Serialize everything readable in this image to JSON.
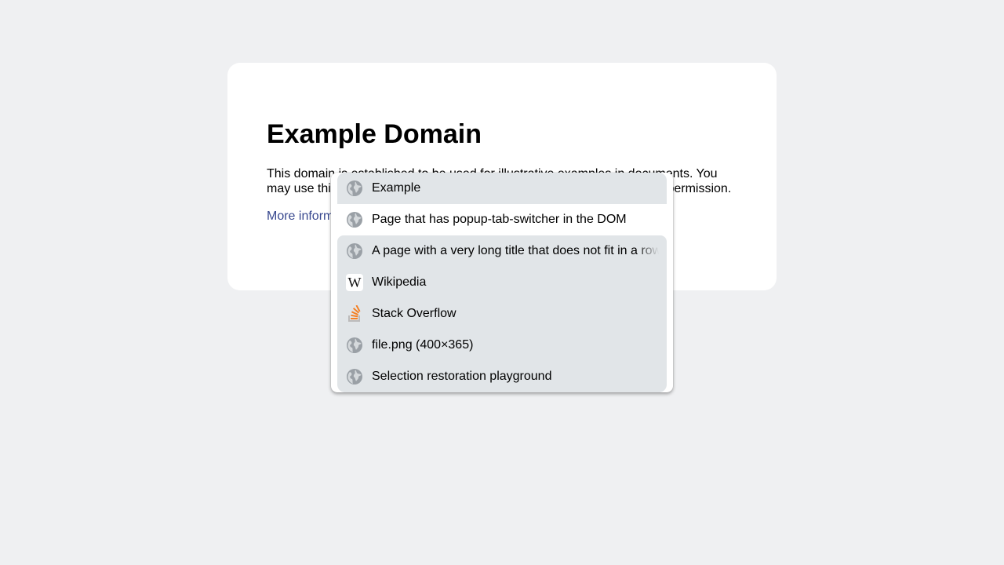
{
  "page": {
    "title": "Example Domain",
    "description": "This domain is established to be used for illustrative examples in documents. You may use this domain in literature without prior coordination or asking for permission.",
    "more_link": "More information..."
  },
  "tab_switcher": {
    "selected_index": 1,
    "items": [
      {
        "title": "Example",
        "icon": "globe-icon"
      },
      {
        "title": "Page that has popup-tab-switcher in the DOM",
        "icon": "globe-icon"
      },
      {
        "title": "A page with a very long title that does not fit in a row",
        "icon": "globe-icon"
      },
      {
        "title": "Wikipedia",
        "icon": "wikipedia-icon"
      },
      {
        "title": "Stack Overflow",
        "icon": "stackoverflow-icon"
      },
      {
        "title": "file.png (400×365)",
        "icon": "globe-icon"
      },
      {
        "title": "Selection restoration playground",
        "icon": "globe-icon"
      }
    ]
  },
  "colors": {
    "background": "#eff0f2",
    "card": "#ffffff",
    "link": "#38488f",
    "row": "#e1e5e8",
    "row_selected": "#ffffff",
    "globe": "#9aa0a6",
    "stackoverflow_orange": "#f48024"
  }
}
